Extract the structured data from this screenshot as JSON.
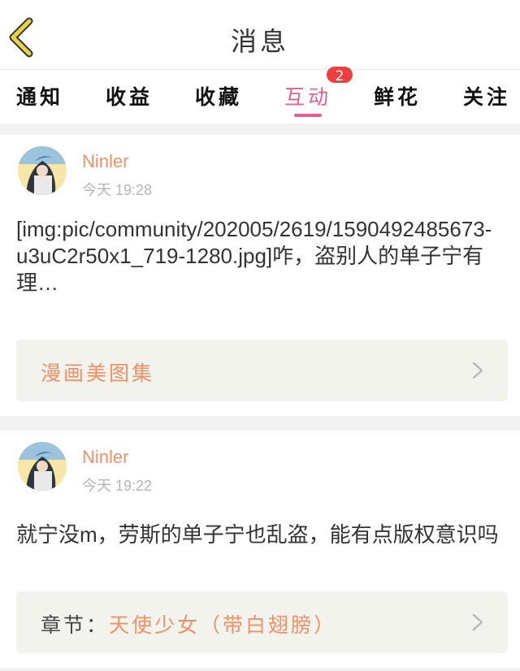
{
  "header": {
    "title": "消息",
    "back_icon": "chevron-left-icon"
  },
  "colors": {
    "accent": "#e85d8e",
    "username": "#f19066",
    "badge": "#ee3f3f",
    "back_icon": "#e8d442"
  },
  "tabs": [
    {
      "label": "通知"
    },
    {
      "label": "收益"
    },
    {
      "label": "收藏"
    },
    {
      "label": "互动",
      "active": true,
      "badge": "2"
    },
    {
      "label": "鲜花"
    },
    {
      "label": "关注"
    }
  ],
  "messages": [
    {
      "username": "Ninler",
      "time": "今天 19:28",
      "content": "[img:pic/community/202005/2619/1590492485673-u3uC2r50x1_719-1280.jpg]咋，盗别人的单子宁有理…",
      "ref_prefix": "",
      "ref_title": "漫画美图集"
    },
    {
      "username": "Ninler",
      "time": "今天 19:22",
      "content": "就宁没m，劳斯的单子宁也乱盗，能有点版权意识吗",
      "ref_prefix": "章节：",
      "ref_title": "天使少女（带白翅膀）"
    }
  ]
}
